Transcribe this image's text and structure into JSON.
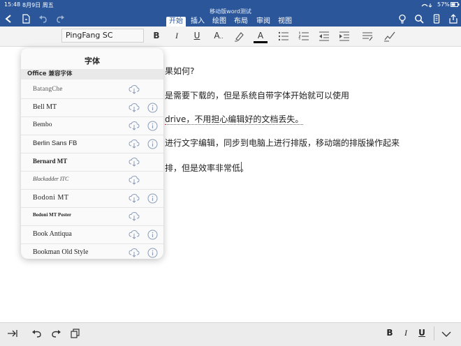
{
  "status_bar": {
    "time": "15:48",
    "date": "8月9日 周五",
    "battery": "57%"
  },
  "window": {
    "title": "移动版word测试"
  },
  "tabs": [
    {
      "label": "开始",
      "active": true
    },
    {
      "label": "插入",
      "active": false
    },
    {
      "label": "绘图",
      "active": false
    },
    {
      "label": "布局",
      "active": false
    },
    {
      "label": "审阅",
      "active": false
    },
    {
      "label": "视图",
      "active": false
    }
  ],
  "ribbon": {
    "font_name": "PingFang SC",
    "bold_label": "B",
    "italic_label": "I",
    "underline_label": "U",
    "font_size_label": "A",
    "font_color_label": "A"
  },
  "font_panel": {
    "title": "字体",
    "section": "Office 兼容字体",
    "fonts": [
      {
        "name": "BatangChe",
        "info": false
      },
      {
        "name": "Bell MT",
        "info": true
      },
      {
        "name": "Bembo",
        "info": true
      },
      {
        "name": "Berlin Sans FB",
        "info": true
      },
      {
        "name": "Bernard MT",
        "info": false
      },
      {
        "name": "Blackadder ITC",
        "info": false
      },
      {
        "name": "Bodoni MT",
        "info": true
      },
      {
        "name": "Bodoni MT Poster",
        "info": false
      },
      {
        "name": "Book Antiqua",
        "info": true
      },
      {
        "name": "Bookman Old Style",
        "info": true
      }
    ]
  },
  "document": {
    "lines": [
      "果如何?",
      "是需要下载的，但是系统自带字体开始就可以使用",
      "drive，不用担心编辑好的文档丢失。",
      "进行文字编辑，同步到电脑上进行排版，移动端的排版操作起来",
      "排，但是效率非常低。"
    ]
  },
  "bottom_toolbar": {
    "bold_label": "B",
    "italic_label": "I",
    "underline_label": "U"
  },
  "colors": {
    "brand": "#2b579a",
    "font_color_bar": "#000000"
  }
}
